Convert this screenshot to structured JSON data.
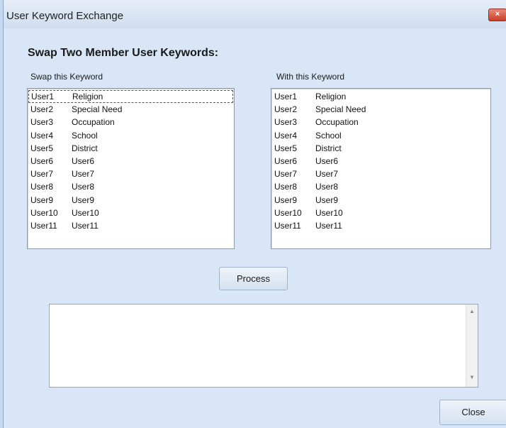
{
  "window": {
    "title": "User Keyword Exchange",
    "close_glyph": "×"
  },
  "heading": "Swap Two Member User Keywords:",
  "left_list": {
    "label": "Swap this Keyword",
    "items": [
      {
        "key": "User1",
        "value": "Religion"
      },
      {
        "key": "User2",
        "value": "Special Need"
      },
      {
        "key": "User3",
        "value": "Occupation"
      },
      {
        "key": "User4",
        "value": "School"
      },
      {
        "key": "User5",
        "value": "District"
      },
      {
        "key": "User6",
        "value": "User6"
      },
      {
        "key": "User7",
        "value": "User7"
      },
      {
        "key": "User8",
        "value": "User8"
      },
      {
        "key": "User9",
        "value": "User9"
      },
      {
        "key": "User10",
        "value": "User10"
      },
      {
        "key": "User11",
        "value": "User11"
      }
    ]
  },
  "right_list": {
    "label": "With this Keyword",
    "items": [
      {
        "key": "User1",
        "value": "Religion"
      },
      {
        "key": "User2",
        "value": "Special Need"
      },
      {
        "key": "User3",
        "value": "Occupation"
      },
      {
        "key": "User4",
        "value": "School"
      },
      {
        "key": "User5",
        "value": "District"
      },
      {
        "key": "User6",
        "value": "User6"
      },
      {
        "key": "User7",
        "value": "User7"
      },
      {
        "key": "User8",
        "value": "User8"
      },
      {
        "key": "User9",
        "value": "User9"
      },
      {
        "key": "User10",
        "value": "User10"
      },
      {
        "key": "User11",
        "value": "User11"
      }
    ]
  },
  "process_button": "Process",
  "output_text": "",
  "close_button": "Close",
  "scroll_up_glyph": "▲",
  "scroll_down_glyph": "▼"
}
